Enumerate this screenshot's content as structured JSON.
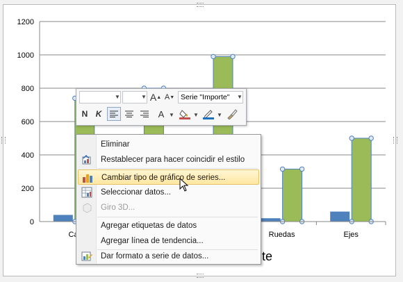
{
  "chart_data": {
    "type": "bar",
    "categories": [
      "Caj",
      "",
      "",
      "Ruedas",
      "Ejes"
    ],
    "ylim": [
      0,
      1200
    ],
    "yticks": [
      0,
      200,
      400,
      600,
      800,
      1000,
      1200
    ],
    "series": [
      {
        "values": [
          40,
          null,
          null,
          20,
          60
        ],
        "color": "#4f81bd"
      },
      {
        "name": "Importe",
        "values": [
          740,
          800,
          990,
          315,
          500
        ],
        "color": "#9bbb59"
      }
    ],
    "xlabel_partial": "te",
    "grid": true
  },
  "minitoolbar": {
    "font_name": "",
    "font_size": "",
    "grow_font": "A",
    "shrink_font": "A",
    "series_selector": "Serie \"Importe\"",
    "bold": "N",
    "italic": "K",
    "font_color_letter": "A"
  },
  "context_menu": {
    "items": [
      {
        "label": "Eliminar",
        "icon": "none",
        "enabled": true
      },
      {
        "label": "Restablecer para hacer coincidir el estilo",
        "icon": "reset-style-icon",
        "enabled": true
      },
      {
        "label": "Cambiar tipo de gráfico de series...",
        "icon": "chart-type-icon",
        "enabled": true,
        "highlighted": true
      },
      {
        "label": "Seleccionar datos...",
        "icon": "select-data-icon",
        "enabled": true
      },
      {
        "label": "Giro 3D...",
        "icon": "rotation-3d-icon",
        "enabled": false
      },
      {
        "label": "Agregar etiquetas de datos",
        "icon": "none",
        "enabled": true
      },
      {
        "label": "Agregar línea de tendencia...",
        "icon": "none",
        "enabled": true
      },
      {
        "label": "Dar formato a serie de datos...",
        "icon": "format-series-icon",
        "enabled": true
      }
    ]
  },
  "colors": {
    "series1": "#4f81bd",
    "series2": "#9bbb59",
    "menu_highlight": "#ffe7a2"
  }
}
